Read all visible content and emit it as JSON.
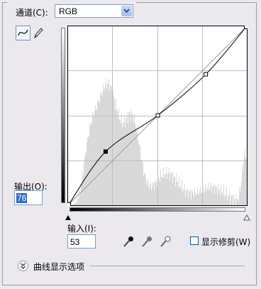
{
  "channel": {
    "label": "通道(C):",
    "value": "RGB"
  },
  "output": {
    "label": "输出(O):",
    "value": "76"
  },
  "input": {
    "label": "输入(I):",
    "value": "53"
  },
  "show_clipping": {
    "label": "显示修剪(W)",
    "checked": false
  },
  "curve_options": {
    "label": "曲线显示选项"
  },
  "tools": {
    "curve": "curve-point-icon",
    "pencil": "pencil-icon"
  },
  "eyedroppers": [
    "black-eyedropper-icon",
    "gray-eyedropper-icon",
    "white-eyedropper-icon"
  ],
  "curve_points": [
    [
      0,
      0
    ],
    [
      53,
      76
    ],
    [
      128,
      128
    ],
    [
      197,
      187
    ],
    [
      255,
      255
    ]
  ],
  "colors": {
    "selection": "#316ac5",
    "histogram": "#d9d9d9",
    "panel": "#ebe9ed"
  }
}
